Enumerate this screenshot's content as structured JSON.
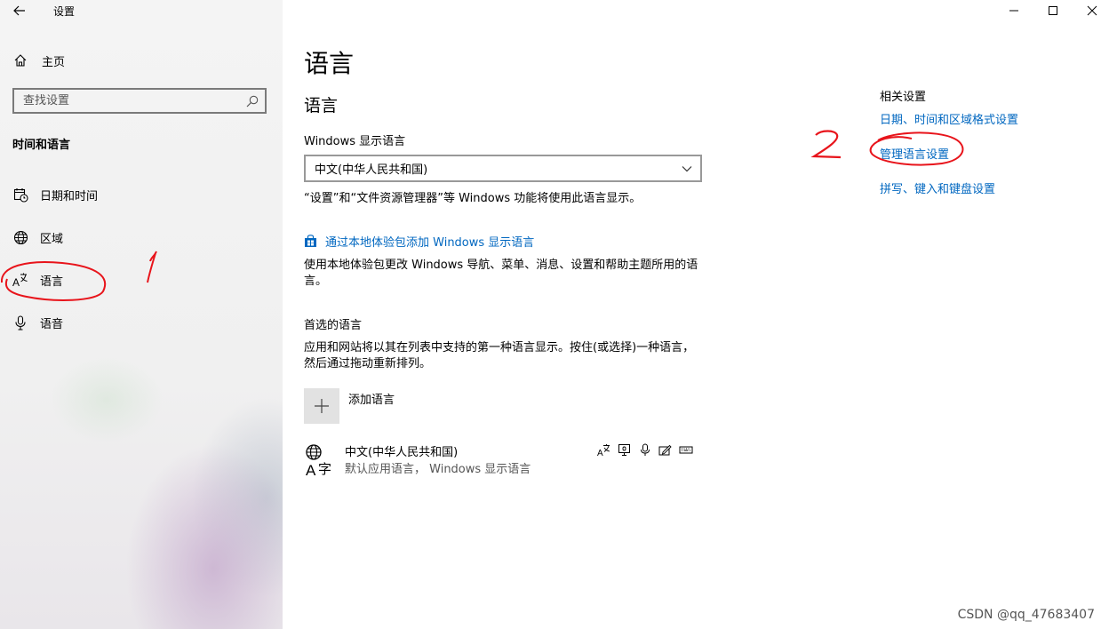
{
  "window": {
    "title": "设置"
  },
  "sidebar": {
    "home_label": "主页",
    "search_placeholder": "查找设置",
    "section_title": "时间和语言",
    "items": [
      {
        "label": "日期和时间",
        "icon": "calendar-clock-icon"
      },
      {
        "label": "区域",
        "icon": "globe-icon"
      },
      {
        "label": "语言",
        "icon": "language-icon"
      },
      {
        "label": "语音",
        "icon": "microphone-icon"
      }
    ]
  },
  "main": {
    "page_title": "语言",
    "section_title": "语言",
    "display_language": {
      "label": "Windows 显示语言",
      "selected": "中文(中华人民共和国)",
      "note": "“设置”和“文件资源管理器”等 Windows 功能将使用此语言显示。"
    },
    "store_link": {
      "label": "通过本地体验包添加 Windows 显示语言",
      "description": "使用本地体验包更改 Windows 导航、菜单、消息、设置和帮助主题所用的语言。"
    },
    "preferred": {
      "title": "首选的语言",
      "description": "应用和网站将以其在列表中支持的第一种语言显示。按住(或选择)一种语言，然后通过拖动重新排列。",
      "add_label": "添加语言",
      "languages": [
        {
          "name": "中文(中华人民共和国)",
          "detail": "默认应用语言， Windows 显示语言"
        }
      ]
    }
  },
  "related": {
    "title": "相关设置",
    "links": [
      "日期、时间和区域格式设置",
      "管理语言设置",
      "拼写、键入和键盘设置"
    ]
  },
  "annotations": {
    "mark_1": "1",
    "mark_2": "2",
    "color": "#e8141b"
  },
  "colors": {
    "link": "#0067c0"
  },
  "watermark": "CSDN @qq_47683407"
}
